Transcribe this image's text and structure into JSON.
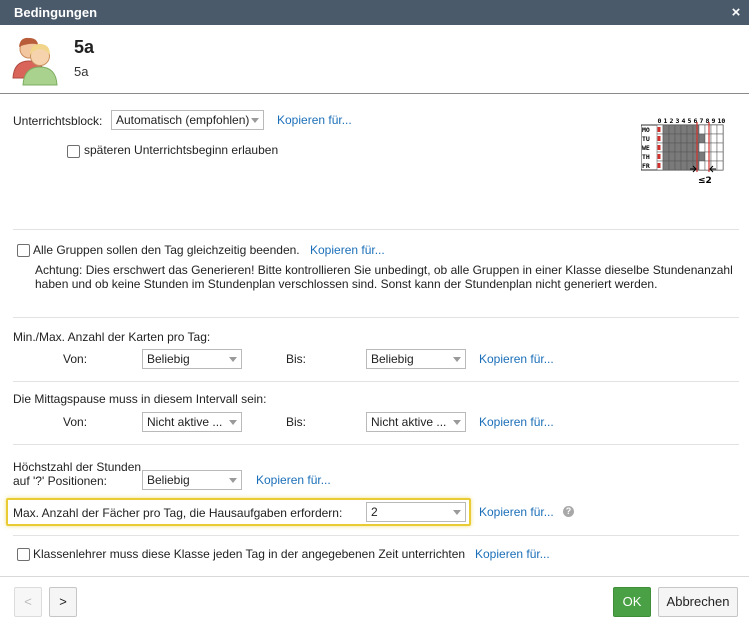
{
  "dialog": {
    "title": "Bedingungen",
    "close_icon": "×"
  },
  "header": {
    "title": "5a",
    "subtitle": "5a"
  },
  "block": {
    "label": "Unterrichtsblock:",
    "select_value": "Automatisch (empfohlen)",
    "copy_link": "Kopieren für..."
  },
  "late_start": {
    "label": "späteren Unterrichtsbeginn erlauben",
    "checked": false
  },
  "schedule_icon": {
    "hours": [
      "0",
      "1",
      "2",
      "3",
      "4",
      "5",
      "6",
      "7",
      "8",
      "9",
      "10"
    ],
    "days": [
      "MO",
      "TU",
      "WE",
      "TH",
      "FR"
    ],
    "note": "≤2"
  },
  "groups_end": {
    "label": "Alle Gruppen sollen den Tag gleichzeitig beenden.",
    "copy_link": "Kopieren für...",
    "checked": false,
    "warning": "Achtung: Dies erschwert das Generieren! Bitte kontrollieren Sie unbedingt, ob alle Gruppen in einer Klasse dieselbe Stundenanzahl haben und ob keine Stunden im Stundenplan verschlossen sind. Sonst kann der Stundenplan nicht generiert werden."
  },
  "cards_per_day": {
    "label": "Min./Max. Anzahl der Karten pro Tag:",
    "from_label": "Von:",
    "from_value": "Beliebig",
    "to_label": "Bis:",
    "to_value": "Beliebig",
    "copy_link": "Kopieren für..."
  },
  "lunch_break": {
    "label": "Die Mittagspause muss in diesem Intervall sein:",
    "from_label": "Von:",
    "from_value": "Nicht aktive ...",
    "to_label": "Bis:",
    "to_value": "Nicht aktive ...",
    "copy_link": "Kopieren für..."
  },
  "max_question": {
    "label_line1": "Höchstzahl der Stunden",
    "label_line2": "auf '?' Positionen:",
    "value": "Beliebig",
    "copy_link": "Kopieren für..."
  },
  "homework": {
    "label": "Max. Anzahl der Fächer pro Tag, die  Hausaufgaben erfordern:",
    "value": "2",
    "copy_link": "Kopieren für...",
    "help_icon": "?"
  },
  "class_teacher": {
    "label": "Klassenlehrer muss diese Klasse jeden Tag in der angegebenen Zeit unterrichten",
    "copy_link": "Kopieren für...",
    "checked": false
  },
  "footer": {
    "prev": "<",
    "next": ">",
    "ok": "OK",
    "cancel": "Abbrechen"
  },
  "colors": {
    "titlebar": "#4a5a6a",
    "link": "#1b6fb8",
    "ok": "#4aa044",
    "highlight": "#e9cc33"
  }
}
